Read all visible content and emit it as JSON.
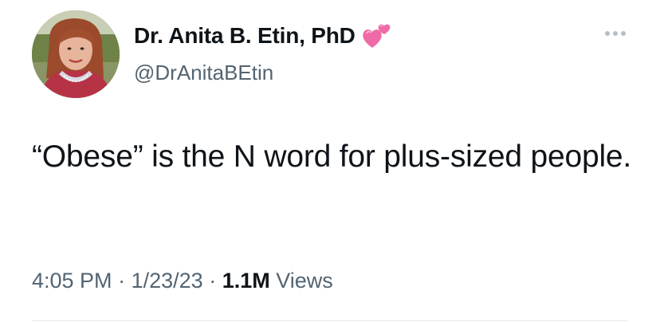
{
  "author": {
    "name": "Dr. Anita B. Etin, PhD",
    "name_emoji": "two-hearts-emoji",
    "handle": "@DrAnitaBEtin"
  },
  "tweet": {
    "text": "“Obese” is the N word for plus-sized people."
  },
  "meta": {
    "time": "4:05 PM",
    "separator": "·",
    "date": "1/23/23",
    "views_count": "1.1M",
    "views_label": "Views"
  },
  "icons": {
    "more": "more-horizontal-icon"
  },
  "colors": {
    "text_primary": "#0f1419",
    "text_secondary": "#536471",
    "heart_pink": "#f06aa8",
    "divider": "#e4e8eb"
  }
}
